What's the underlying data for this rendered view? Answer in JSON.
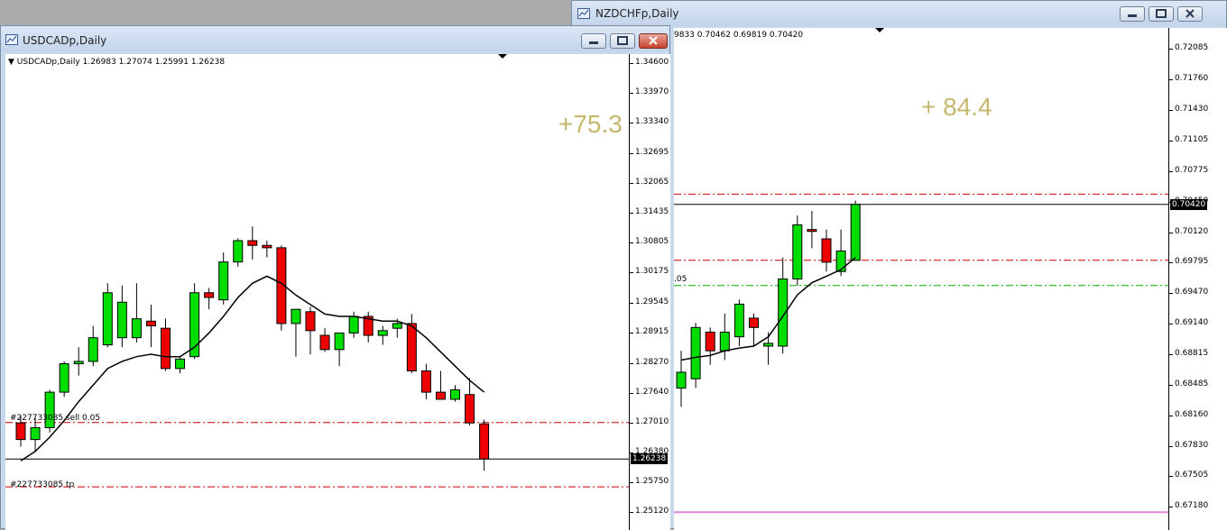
{
  "left_window": {
    "title": "USDCADp,Daily",
    "info_line": "USDCADp,Daily  1.26983 1.27074 1.25991 1.26238",
    "pips": "+75.3",
    "current_price": "1.26238",
    "order_label_sell": "#227733085 sell 0.05",
    "order_label_tp": "#227733085 tp",
    "y_ticks": [
      "1.34600",
      "1.33970",
      "1.33340",
      "1.32695",
      "1.32065",
      "1.31435",
      "1.30805",
      "1.30175",
      "1.29545",
      "1.28915",
      "1.28270",
      "1.27640",
      "1.27010",
      "1.26380",
      "1.25750",
      "1.25120"
    ]
  },
  "right_window": {
    "title": "NZDCHFp,Daily",
    "info_line": "9833 0.70462 0.69819 0.70420",
    "pips": "+ 84.4",
    "current_price": "0.70420",
    "order_label": ".05",
    "y_ticks": [
      "0.72085",
      "0.71760",
      "0.71430",
      "0.71105",
      "0.70775",
      "0.70450",
      "0.70120",
      "0.69795",
      "0.69470",
      "0.69140",
      "0.68815",
      "0.68485",
      "0.68160",
      "0.67830",
      "0.67505",
      "0.67180"
    ]
  },
  "colors": {
    "bull": "#00dd00",
    "bear": "#ee0000",
    "ma": "#000000",
    "sell_line": "#cc0000",
    "tp_line": "#cc0000",
    "green_line": "#00aa00",
    "magenta_line": "#dd88dd",
    "pips_text": "#c5b86e"
  },
  "chart_data": [
    {
      "type": "candlestick",
      "symbol": "USDCADp",
      "timeframe": "Daily",
      "ylim": [
        1.2512,
        1.346
      ],
      "candles": [
        {
          "o": 1.27,
          "h": 1.2715,
          "l": 1.265,
          "c": 1.2665
        },
        {
          "o": 1.2665,
          "h": 1.271,
          "l": 1.264,
          "c": 1.269
        },
        {
          "o": 1.269,
          "h": 1.277,
          "l": 1.268,
          "c": 1.2765
        },
        {
          "o": 1.2765,
          "h": 1.283,
          "l": 1.2755,
          "c": 1.2825
        },
        {
          "o": 1.2825,
          "h": 1.286,
          "l": 1.28,
          "c": 1.283
        },
        {
          "o": 1.283,
          "h": 1.2905,
          "l": 1.282,
          "c": 1.288
        },
        {
          "o": 1.2865,
          "h": 1.2995,
          "l": 1.286,
          "c": 1.2975
        },
        {
          "o": 1.288,
          "h": 1.299,
          "l": 1.286,
          "c": 1.2955
        },
        {
          "o": 1.288,
          "h": 1.2995,
          "l": 1.287,
          "c": 1.292
        },
        {
          "o": 1.2915,
          "h": 1.295,
          "l": 1.286,
          "c": 1.2905
        },
        {
          "o": 1.29,
          "h": 1.292,
          "l": 1.281,
          "c": 1.2815
        },
        {
          "o": 1.2815,
          "h": 1.284,
          "l": 1.2805,
          "c": 1.2835
        },
        {
          "o": 1.284,
          "h": 1.2995,
          "l": 1.2835,
          "c": 1.2975
        },
        {
          "o": 1.2975,
          "h": 1.2985,
          "l": 1.294,
          "c": 1.2965
        },
        {
          "o": 1.296,
          "h": 1.306,
          "l": 1.295,
          "c": 1.304
        },
        {
          "o": 1.304,
          "h": 1.309,
          "l": 1.303,
          "c": 1.3085
        },
        {
          "o": 1.3085,
          "h": 1.3115,
          "l": 1.3045,
          "c": 1.3075
        },
        {
          "o": 1.3075,
          "h": 1.3085,
          "l": 1.305,
          "c": 1.307
        },
        {
          "o": 1.307,
          "h": 1.3075,
          "l": 1.2895,
          "c": 1.291
        },
        {
          "o": 1.291,
          "h": 1.294,
          "l": 1.284,
          "c": 1.294
        },
        {
          "o": 1.2935,
          "h": 1.2945,
          "l": 1.2845,
          "c": 1.2895
        },
        {
          "o": 1.2885,
          "h": 1.29,
          "l": 1.285,
          "c": 1.2855
        },
        {
          "o": 1.2855,
          "h": 1.289,
          "l": 1.282,
          "c": 1.289
        },
        {
          "o": 1.289,
          "h": 1.2935,
          "l": 1.288,
          "c": 1.2925
        },
        {
          "o": 1.2925,
          "h": 1.2935,
          "l": 1.287,
          "c": 1.2885
        },
        {
          "o": 1.2885,
          "h": 1.2905,
          "l": 1.2865,
          "c": 1.2895
        },
        {
          "o": 1.29,
          "h": 1.292,
          "l": 1.288,
          "c": 1.291
        },
        {
          "o": 1.291,
          "h": 1.293,
          "l": 1.2805,
          "c": 1.281
        },
        {
          "o": 1.281,
          "h": 1.2825,
          "l": 1.275,
          "c": 1.2765
        },
        {
          "o": 1.2765,
          "h": 1.281,
          "l": 1.275,
          "c": 1.275
        },
        {
          "o": 1.275,
          "h": 1.278,
          "l": 1.2745,
          "c": 1.277
        },
        {
          "o": 1.276,
          "h": 1.2795,
          "l": 1.2695,
          "c": 1.27
        },
        {
          "o": 1.2698,
          "h": 1.2707,
          "l": 1.2599,
          "c": 1.2624
        }
      ],
      "moving_average": [
        1.262,
        1.264,
        1.267,
        1.2705,
        1.2745,
        1.278,
        1.2815,
        1.283,
        1.284,
        1.2845,
        1.284,
        1.284,
        1.286,
        1.289,
        1.2925,
        1.2965,
        1.2995,
        1.301,
        1.2995,
        1.297,
        1.295,
        1.293,
        1.2925,
        1.2925,
        1.292,
        1.2915,
        1.2915,
        1.2905,
        1.288,
        1.285,
        1.282,
        1.279,
        1.2765
      ],
      "levels": [
        {
          "name": "sell",
          "value": 1.2701,
          "style": "dashdot"
        },
        {
          "name": "tp",
          "value": 1.2565,
          "style": "dashdot"
        },
        {
          "name": "price",
          "value": 1.26238,
          "style": "solid"
        }
      ]
    },
    {
      "type": "candlestick",
      "symbol": "NZDCHFp",
      "timeframe": "Daily",
      "ylim": [
        0.6718,
        0.7235
      ],
      "candles": [
        {
          "o": 0.6845,
          "h": 0.6885,
          "l": 0.6825,
          "c": 0.6862
        },
        {
          "o": 0.6855,
          "h": 0.6915,
          "l": 0.6845,
          "c": 0.691
        },
        {
          "o": 0.6905,
          "h": 0.691,
          "l": 0.687,
          "c": 0.6885
        },
        {
          "o": 0.6885,
          "h": 0.6925,
          "l": 0.6875,
          "c": 0.6905
        },
        {
          "o": 0.69,
          "h": 0.694,
          "l": 0.689,
          "c": 0.6935
        },
        {
          "o": 0.692,
          "h": 0.6925,
          "l": 0.689,
          "c": 0.691
        },
        {
          "o": 0.689,
          "h": 0.6905,
          "l": 0.687,
          "c": 0.6893
        },
        {
          "o": 0.689,
          "h": 0.6985,
          "l": 0.6882,
          "c": 0.6962
        },
        {
          "o": 0.6962,
          "h": 0.703,
          "l": 0.6955,
          "c": 0.702
        },
        {
          "o": 0.7015,
          "h": 0.7035,
          "l": 0.6995,
          "c": 0.7013
        },
        {
          "o": 0.7005,
          "h": 0.7015,
          "l": 0.697,
          "c": 0.698
        },
        {
          "o": 0.697,
          "h": 0.7015,
          "l": 0.6965,
          "c": 0.6992
        },
        {
          "o": 0.6982,
          "h": 0.7046,
          "l": 0.6982,
          "c": 0.7042
        }
      ],
      "moving_average": [
        0.6875,
        0.6878,
        0.688,
        0.6885,
        0.6888,
        0.689,
        0.69,
        0.6922,
        0.6945,
        0.6958,
        0.6965,
        0.6972,
        0.6985
      ],
      "levels": [
        {
          "name": "upper",
          "value": 0.7053,
          "style": "dashdot"
        },
        {
          "name": "lower",
          "value": 0.6982,
          "style": "dashdot"
        },
        {
          "name": "order",
          "value": 0.6955,
          "style": "dashdot"
        },
        {
          "name": "magenta",
          "value": 0.6712,
          "style": "solid"
        },
        {
          "name": "price",
          "value": 0.7042,
          "style": "solid"
        }
      ]
    }
  ]
}
